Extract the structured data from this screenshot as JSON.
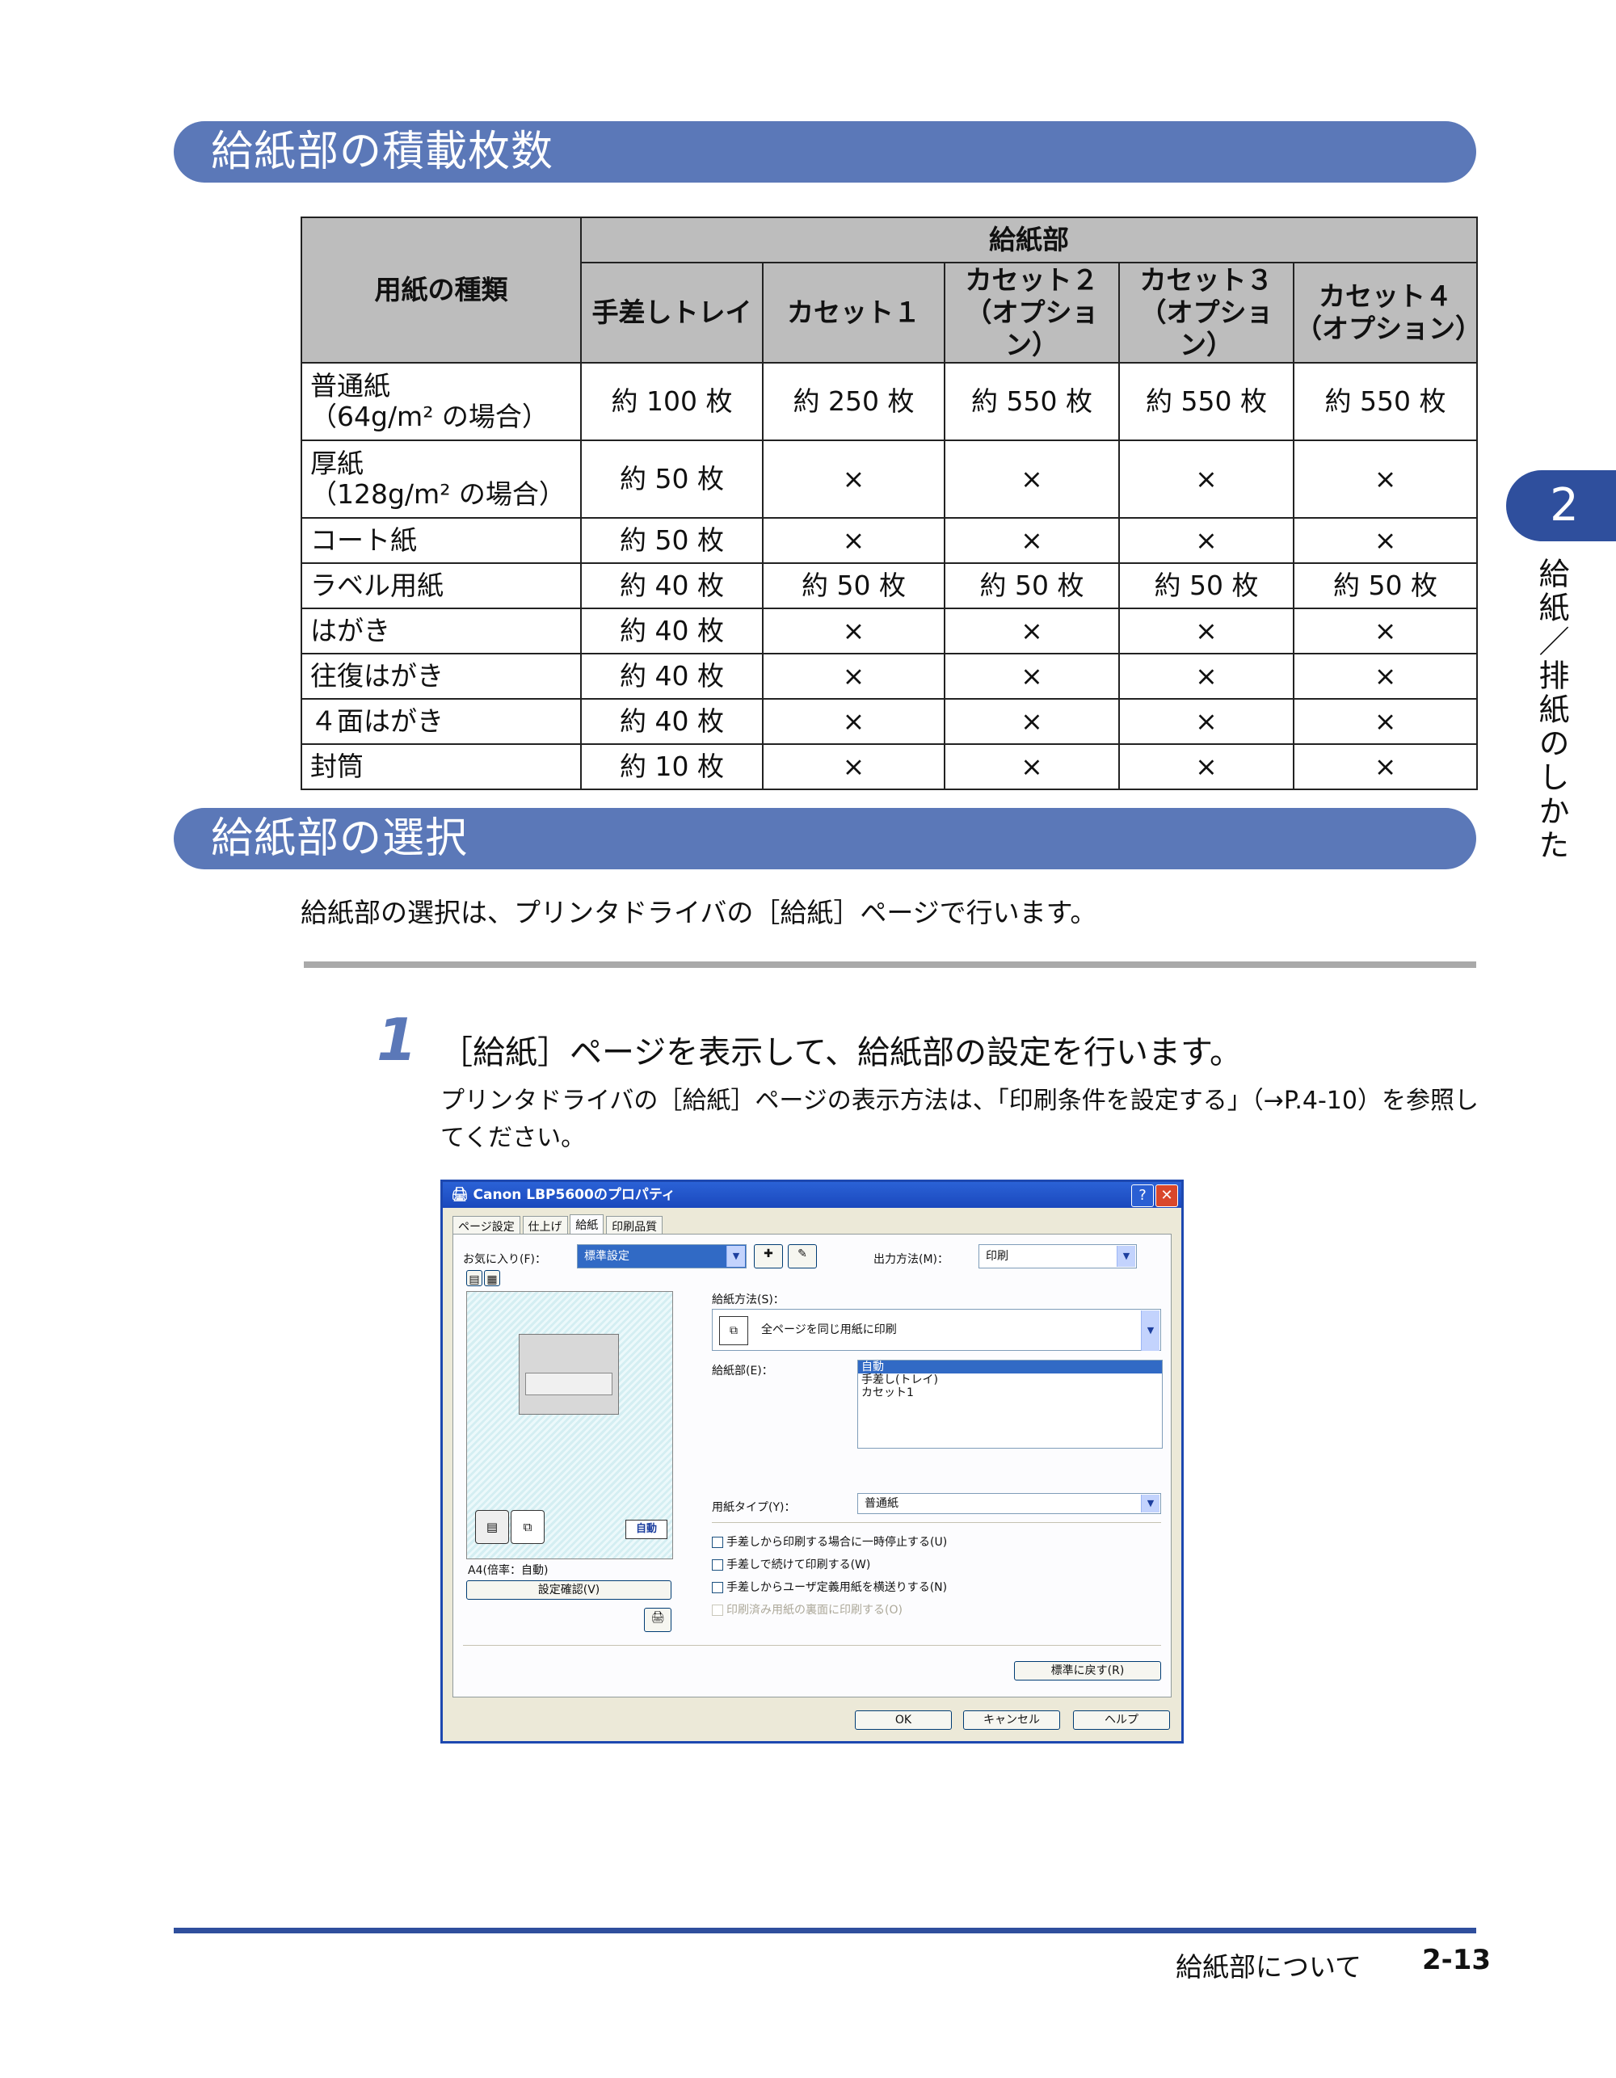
{
  "section1": {
    "title": "給紙部の積載枚数"
  },
  "table": {
    "header_type": "用紙の種類",
    "header_group": "給紙部",
    "columns": [
      "手差しトレイ",
      "カセット１",
      "カセット２\n（オプション）",
      "カセット３\n（オプション）",
      "カセット４\n（オプション）"
    ],
    "rows": [
      {
        "type": "普通紙\n（64g/m² の場合）",
        "cells": [
          "約 100 枚",
          "約 250 枚",
          "約 550 枚",
          "約 550 枚",
          "約 550 枚"
        ]
      },
      {
        "type": "厚紙\n（128g/m² の場合）",
        "cells": [
          "約 50 枚",
          "×",
          "×",
          "×",
          "×"
        ]
      },
      {
        "type": "コート紙",
        "cells": [
          "約 50 枚",
          "×",
          "×",
          "×",
          "×"
        ]
      },
      {
        "type": "ラベル用紙",
        "cells": [
          "約 40 枚",
          "約 50 枚",
          "約 50 枚",
          "約 50 枚",
          "約 50 枚"
        ]
      },
      {
        "type": "はがき",
        "cells": [
          "約 40 枚",
          "×",
          "×",
          "×",
          "×"
        ]
      },
      {
        "type": "往復はがき",
        "cells": [
          "約 40 枚",
          "×",
          "×",
          "×",
          "×"
        ]
      },
      {
        "type": "４面はがき",
        "cells": [
          "約 40 枚",
          "×",
          "×",
          "×",
          "×"
        ]
      },
      {
        "type": "封筒",
        "cells": [
          "約 10 枚",
          "×",
          "×",
          "×",
          "×"
        ]
      }
    ]
  },
  "section2": {
    "title": "給紙部の選択",
    "intro": "給紙部の選択は、プリンタドライバの［給紙］ページで行います。"
  },
  "step": {
    "number": "1",
    "title": "［給紙］ページを表示して、給紙部の設定を行います。",
    "desc": "プリンタドライバの［給紙］ページの表示方法は、「印刷条件を設定する」（→P.4-10）を参照してください。"
  },
  "dialog": {
    "title": "Canon LBP5600のプロパティ",
    "help_btn": "?",
    "close_btn": "✕",
    "tabs": [
      "ページ設定",
      "仕上げ",
      "給紙",
      "印刷品質"
    ],
    "favorites_label": "お気に入り(F)：",
    "favorites_value": "標準設定",
    "output_label": "出力方法(M)：",
    "output_value": "印刷",
    "feed_method_label": "給紙方法(S)：",
    "feed_method_value": "全ページを同じ用紙に印刷",
    "source_label": "給紙部(E)：",
    "source_options": [
      "自動",
      "手差し(トレイ)",
      "カセット1"
    ],
    "source_selected": "自動",
    "paper_type_label": "用紙タイプ(Y)：",
    "paper_type_value": "普通紙",
    "checks": [
      {
        "label": "手差しから印刷する場合に一時停止する(U)",
        "enabled": true
      },
      {
        "label": "手差しで続けて印刷する(W)",
        "enabled": true
      },
      {
        "label": "手差しからユーザ定義用紙を横送りする(N)",
        "enabled": true
      },
      {
        "label": "印刷済み用紙の裏面に印刷する(O)",
        "enabled": false
      }
    ],
    "preview_badge": "自動",
    "preview_caption": "A4(倍率：自動)",
    "confirm_btn": "設定確認(V)",
    "restore_btn": "標準に戻す(R)",
    "ok_btn": "OK",
    "cancel_btn": "キャンセル",
    "help_bottom_btn": "ヘルプ"
  },
  "side": {
    "chapter": "2",
    "vertical_title": "給紙／排紙のしかた"
  },
  "footer": {
    "title": "給紙部について",
    "page": "2-13"
  }
}
